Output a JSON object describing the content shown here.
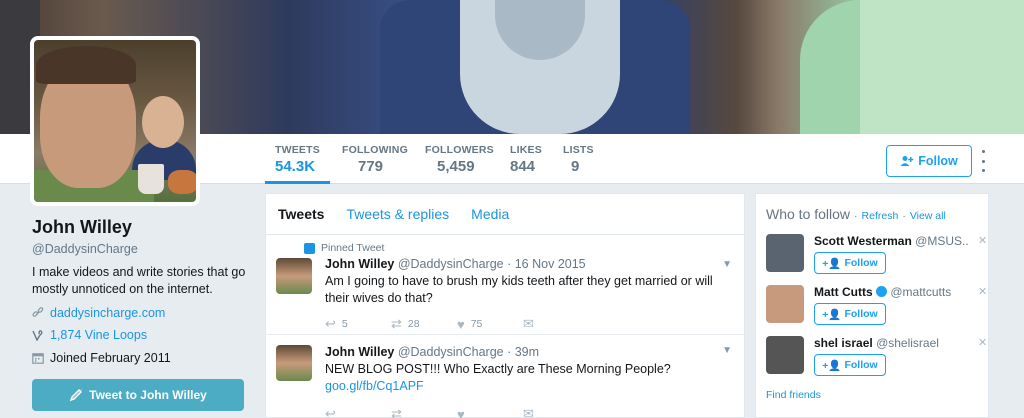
{
  "profile": {
    "name": "John Willey",
    "handle": "@DaddysinCharge",
    "bio": "I make videos and write stories that go mostly unnoticed on the internet.",
    "website": "daddysincharge.com",
    "vine_loops": "1,874 Vine Loops",
    "joined": "Joined February 2011",
    "tweet_to_label": "Tweet to John Willey"
  },
  "stats": [
    {
      "label": "TWEETS",
      "value": "54.3K"
    },
    {
      "label": "FOLLOWING",
      "value": "779"
    },
    {
      "label": "FOLLOWERS",
      "value": "5,459"
    },
    {
      "label": "LIKES",
      "value": "844"
    },
    {
      "label": "LISTS",
      "value": "9"
    }
  ],
  "header": {
    "follow_label": "Follow"
  },
  "timeline": {
    "tabs": [
      "Tweets",
      "Tweets & replies",
      "Media"
    ],
    "tweets": [
      {
        "pinned_label": "Pinned Tweet",
        "name": "John Willey",
        "meta": "@DaddysinCharge · 16 Nov 2015",
        "text": "Am I going to have to brush my kids teeth after they get married or will their wives do that?",
        "replies": "5",
        "retweets": "28",
        "likes": "75"
      },
      {
        "name": "John Willey",
        "meta": "@DaddysinCharge · 39m",
        "text": "NEW BLOG POST!!! Who Exactly are These Morning People?",
        "link": "goo.gl/fb/Cq1APF"
      }
    ]
  },
  "who_to_follow": {
    "title": "Who to follow",
    "refresh": "Refresh",
    "view_all": "View all",
    "follow_label": "Follow",
    "find_friends": "Find friends",
    "suggestions": [
      {
        "name": "Scott Westerman",
        "handle": "@MSUS..",
        "avatar_color": "#5a6470"
      },
      {
        "name": "Matt Cutts",
        "handle": "@mattcutts",
        "avatar_color": "#c79a7e"
      },
      {
        "name": "shel israel",
        "handle": "@shelisrael",
        "avatar_color": "#555555"
      }
    ]
  },
  "colors": {
    "accent": "#1da1f2",
    "tweet_button": "#4cacc4"
  }
}
